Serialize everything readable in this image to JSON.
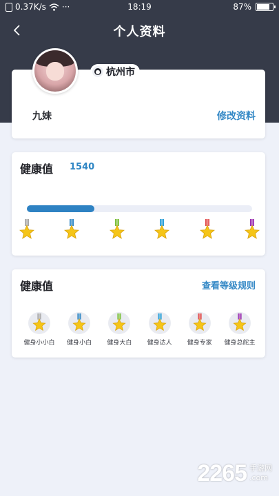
{
  "status_bar": {
    "network_speed": "0.37K/s",
    "dots": "···",
    "time": "18:19",
    "battery": "87%"
  },
  "nav": {
    "title": "个人资料",
    "back_icon": "chevron-left-icon"
  },
  "profile": {
    "city": "杭州市",
    "nickname": "九妹",
    "edit_label": "修改资料"
  },
  "health": {
    "title": "健康值",
    "value": "1540",
    "progress_fraction": 0.3,
    "milestone_colors": [
      "#a6a6a6",
      "#2e86c4",
      "#7bbf3a",
      "#2a9fd8",
      "#e04848",
      "#9a2fb0"
    ]
  },
  "levels": {
    "title": "健康值",
    "rules_label": "查看等级规则",
    "items": [
      {
        "label": "健身小小白",
        "color": "#a6a6a6"
      },
      {
        "label": "健身小白",
        "color": "#2e86c4"
      },
      {
        "label": "健身大白",
        "color": "#7bbf3a"
      },
      {
        "label": "健身达人",
        "color": "#2a9fd8"
      },
      {
        "label": "健身专家",
        "color": "#e04848"
      },
      {
        "label": "健身总舵主",
        "color": "#9a2fb0"
      }
    ]
  },
  "watermark": {
    "number": "2265",
    "suffix": ".com",
    "site": "手游网"
  }
}
